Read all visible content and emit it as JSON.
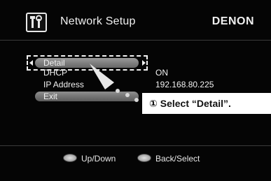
{
  "header": {
    "icon": "tools-icon",
    "title": "Network Setup",
    "brand": "DENON"
  },
  "menu": {
    "items": [
      {
        "label": "Detail",
        "selected": true
      },
      {
        "label": "DHCP",
        "value": "ON"
      },
      {
        "label": "IP Address",
        "value": "192.168.80.225"
      },
      {
        "label": "Exit"
      }
    ]
  },
  "callout": {
    "text": "① Select “Detail”."
  },
  "footer": {
    "up_down": "Up/Down",
    "back_select": "Back/Select"
  },
  "colors": {
    "background": "#050505",
    "text": "#f2f2f2",
    "pill": "#7a7a7a"
  }
}
